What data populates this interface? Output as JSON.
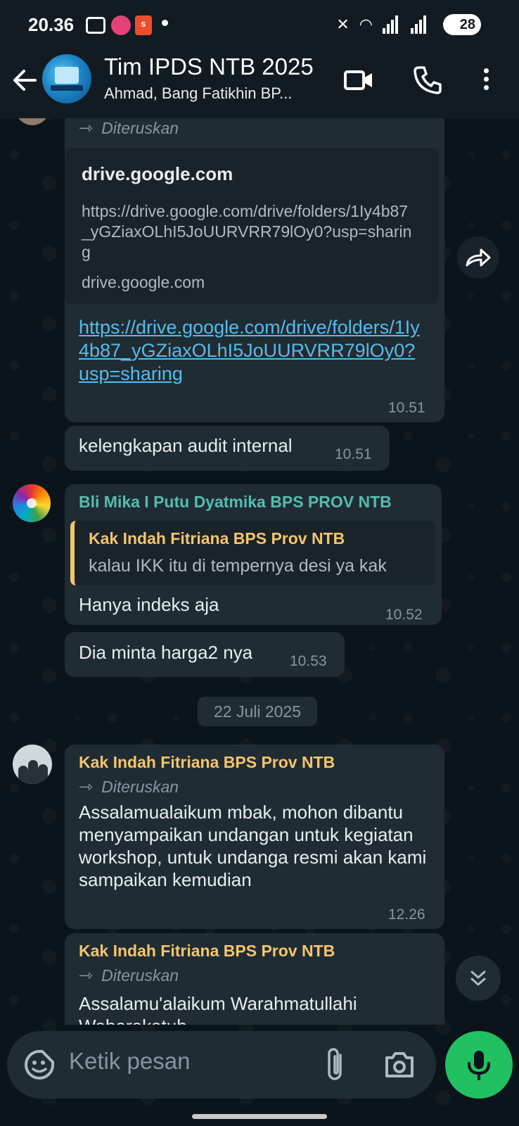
{
  "status_bar": {
    "time": "20.36",
    "battery": "28"
  },
  "header": {
    "title": "Tim IPDS NTB 2025",
    "subtitle": "Ahmad, Bang Fatikhin BP..."
  },
  "messages": {
    "forwarded_label": "Diteruskan",
    "link_msg": {
      "preview_domain": "drive.google.com",
      "preview_url": "https://drive.google.com/drive/folders/1Iy4b87_yGZiaxOLhI5JoUURVRR79lOy0?usp=sharing",
      "preview_footer": "drive.google.com",
      "link_text": "https://drive.google.com/drive/folders/1Iy4b87_yGZiaxOLhI5JoUURVRR79lOy0?usp=sharing",
      "time": "10.51"
    },
    "msg_audit": {
      "text": "kelengkapan audit internal",
      "time": "10.51"
    },
    "msg_mika": {
      "sender": "Bli Mika I Putu Dyatmika BPS PROV NTB",
      "quote_author": "Kak Indah Fitriana BPS Prov NTB",
      "quote_text": "kalau IKK itu di tempernya desi ya kak",
      "text": "Hanya indeks aja",
      "time": "10.52"
    },
    "msg_harga": {
      "text": "Dia minta harga2 nya",
      "time": "10.53"
    },
    "date_divider": "22 Juli 2025",
    "msg_indah1": {
      "sender": "Kak Indah Fitriana BPS Prov NTB",
      "text": "Assalamualaikum mbak, mohon dibantu menyampaikan undangan untuk kegiatan workshop, untuk undanga resmi akan kami sampaikan kemudian",
      "time": "12.26"
    },
    "msg_indah2": {
      "sender": "Kak Indah Fitriana BPS Prov NTB",
      "text": "Assalamu'alaikum Warahmatullahi Wabarakatuh"
    }
  },
  "input": {
    "placeholder": "Ketik pesan"
  },
  "colors": {
    "accent_green": "#21c063",
    "sender_teal": "#53bdb0",
    "sender_gold": "#f5c56b",
    "link_blue": "#53bdeb"
  }
}
